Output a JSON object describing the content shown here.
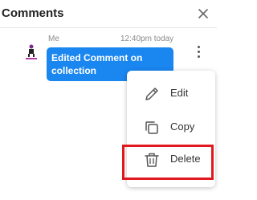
{
  "header": {
    "title": "Comments"
  },
  "comment": {
    "author": "Me",
    "timestamp": "12:40pm today",
    "text": "Edited Comment on collection"
  },
  "menu": {
    "items": [
      {
        "label": "Edit",
        "icon": "pencil-icon"
      },
      {
        "label": "Copy",
        "icon": "copy-icon"
      },
      {
        "label": "Delete",
        "icon": "trash-icon"
      }
    ]
  },
  "colors": {
    "accent": "#1a86f0",
    "highlight": "#e0191f"
  }
}
